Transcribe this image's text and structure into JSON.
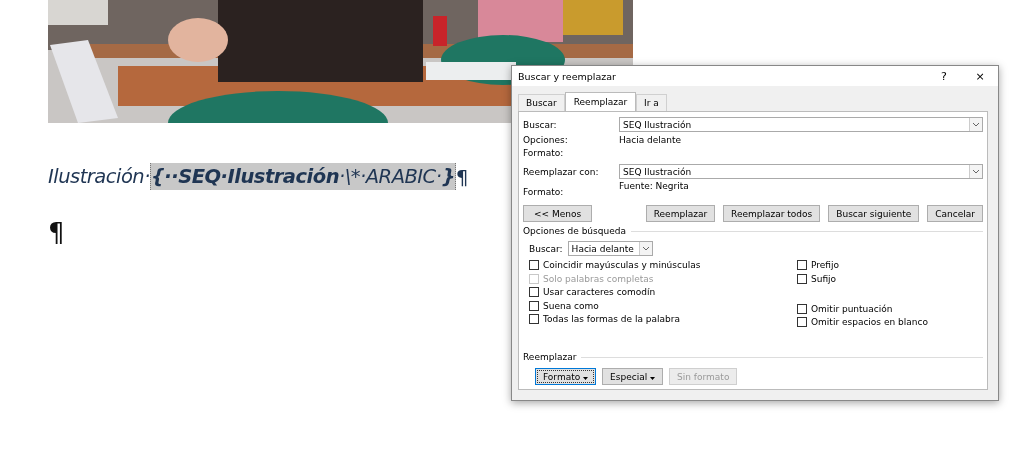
{
  "document": {
    "caption": {
      "label": "Ilustración·",
      "field": [
        {
          "text": "{··SEQ·Ilustración",
          "bold": true
        },
        {
          "text": "·\\*·ARABIC·",
          "bold": false
        },
        {
          "text": "}",
          "bold": true
        }
      ],
      "mark": "¶"
    },
    "empty_paragraph": "¶"
  },
  "dialog": {
    "title": "Buscar y reemplazar",
    "help": "?",
    "close": "×",
    "tabs": [
      {
        "label": "Buscar",
        "selected": false
      },
      {
        "label": "Reemplazar",
        "selected": true
      },
      {
        "label": "Ir a",
        "selected": false
      }
    ],
    "find": {
      "label": "Buscar:",
      "value": "SEQ Ilustración"
    },
    "find_info": [
      {
        "label": "Opciones:",
        "value": "Hacia delante"
      },
      {
        "label": "Formato:"
      }
    ],
    "replace": {
      "label": "Reemplazar con:",
      "value": "SEQ Ilustración"
    },
    "replace_format": {
      "label": "Formato:",
      "value": "Fuente: Negrita"
    },
    "less_button": "<< Menos",
    "action_buttons": [
      "Reemplazar",
      "Reemplazar todos",
      "Buscar siguiente",
      "Cancelar"
    ],
    "search_options": {
      "title": "Opciones de búsqueda",
      "direction_label": "Buscar:",
      "direction_value": "Hacia delante",
      "left_options": [
        {
          "label": "Coincidir mayúsculas y minúsculas",
          "checked": false,
          "disabled": false
        },
        {
          "label": "Solo palabras completas",
          "checked": false,
          "disabled": true
        },
        {
          "label": "Usar caracteres comodín",
          "checked": false,
          "disabled": false
        },
        {
          "label": "Suena como",
          "checked": false,
          "disabled": false
        },
        {
          "label": "Todas las formas de la palabra",
          "checked": false,
          "disabled": false
        }
      ],
      "right_option_groups": [
        [
          {
            "label": "Prefijo",
            "checked": false,
            "disabled": false
          },
          {
            "label": "Sufijo",
            "checked": false,
            "disabled": false
          }
        ],
        [
          {
            "label": "Omitir puntuación",
            "checked": false,
            "disabled": false
          },
          {
            "label": "Omitir espacios en blanco",
            "checked": false,
            "disabled": false
          }
        ]
      ]
    },
    "replace_section": {
      "title": "Reemplazar",
      "buttons": [
        {
          "label": "Formato",
          "dropdown": true,
          "disabled": false,
          "focused": true
        },
        {
          "label": "Especial",
          "dropdown": true,
          "disabled": false,
          "focused": false
        },
        {
          "label": "Sin formato",
          "dropdown": false,
          "disabled": true,
          "focused": false
        }
      ]
    }
  }
}
